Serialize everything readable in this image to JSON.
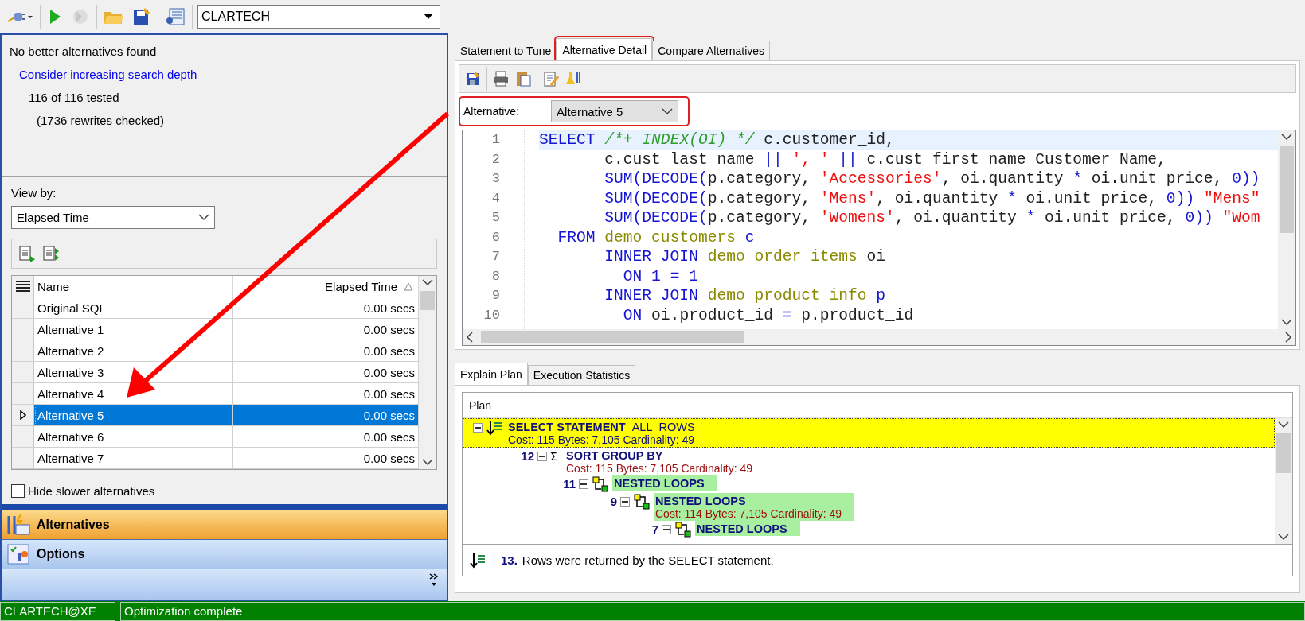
{
  "toolbar": {
    "connection": "CLARTECH"
  },
  "summary": {
    "message": "No better alternatives found",
    "link": "Consider increasing search depth",
    "tested": "116 of 116 tested",
    "rewrites": "(1736 rewrites checked)"
  },
  "view_by": {
    "label": "View by:",
    "value": "Elapsed Time"
  },
  "alternatives_table": {
    "columns": [
      {
        "label": "Name",
        "sorted": false
      },
      {
        "label": "Elapsed Time",
        "sorted": true
      }
    ],
    "rows": [
      {
        "name": "Original SQL",
        "elapsed": "0.00 secs",
        "selected": false
      },
      {
        "name": "Alternative 1",
        "elapsed": "0.00 secs",
        "selected": false
      },
      {
        "name": "Alternative 2",
        "elapsed": "0.00 secs",
        "selected": false
      },
      {
        "name": "Alternative 3",
        "elapsed": "0.00 secs",
        "selected": false
      },
      {
        "name": "Alternative 4",
        "elapsed": "0.00 secs",
        "selected": false
      },
      {
        "name": "Alternative 5",
        "elapsed": "0.00 secs",
        "selected": true
      },
      {
        "name": "Alternative 6",
        "elapsed": "0.00 secs",
        "selected": false
      },
      {
        "name": "Alternative 7",
        "elapsed": "0.00 secs",
        "selected": false
      }
    ]
  },
  "hide_slower": {
    "label": "Hide slower alternatives",
    "checked": false
  },
  "navigation": [
    {
      "label": "Alternatives",
      "selected": true
    },
    {
      "label": "Options",
      "selected": false
    }
  ],
  "tabs": [
    {
      "label": "Statement to Tune",
      "selected": false,
      "highlighted": false
    },
    {
      "label": "Alternative Detail",
      "selected": true,
      "highlighted": true
    },
    {
      "label": "Compare Alternatives",
      "selected": false,
      "highlighted": false
    }
  ],
  "detail": {
    "alternative_label": "Alternative:",
    "alternative_value": "Alternative 5",
    "highlighted": true,
    "code_lines": [
      {
        "number": "1",
        "tokens": [
          {
            "kind": "kw",
            "text": "SELECT"
          },
          {
            "kind": "cm",
            "text": " /*+ INDEX(OI) */"
          },
          {
            "kind": "id",
            "text": " c.customer_id,"
          }
        ]
      },
      {
        "number": "2",
        "tokens": [
          {
            "kind": "id",
            "text": "       c.cust_last_name "
          },
          {
            "kind": "op",
            "text": "||"
          },
          {
            "kind": "str",
            "text": " ', '"
          },
          {
            "kind": "op",
            "text": " ||"
          },
          {
            "kind": "id",
            "text": " c.cust_first_name Customer_Name,"
          }
        ]
      },
      {
        "number": "3",
        "tokens": [
          {
            "kind": "kw",
            "text": "       SUM(DECODE("
          },
          {
            "kind": "id",
            "text": "p.category, "
          },
          {
            "kind": "str",
            "text": "'Accessories'"
          },
          {
            "kind": "id",
            "text": ", oi.quantity "
          },
          {
            "kind": "op",
            "text": "*"
          },
          {
            "kind": "id",
            "text": " oi.unit_price, "
          },
          {
            "kind": "num",
            "text": "0"
          },
          {
            "kind": "kw",
            "text": "))"
          }
        ]
      },
      {
        "number": "4",
        "tokens": [
          {
            "kind": "kw",
            "text": "       SUM(DECODE("
          },
          {
            "kind": "id",
            "text": "p.category, "
          },
          {
            "kind": "str",
            "text": "'Mens'"
          },
          {
            "kind": "id",
            "text": ", oi.quantity "
          },
          {
            "kind": "op",
            "text": "*"
          },
          {
            "kind": "id",
            "text": " oi.unit_price, "
          },
          {
            "kind": "num",
            "text": "0"
          },
          {
            "kind": "kw",
            "text": "))"
          },
          {
            "kind": "str",
            "text": " \"Mens\""
          }
        ]
      },
      {
        "number": "5",
        "tokens": [
          {
            "kind": "kw",
            "text": "       SUM(DECODE("
          },
          {
            "kind": "id",
            "text": "p.category, "
          },
          {
            "kind": "str",
            "text": "'Womens'"
          },
          {
            "kind": "id",
            "text": ", oi.quantity "
          },
          {
            "kind": "op",
            "text": "*"
          },
          {
            "kind": "id",
            "text": " oi.unit_price, "
          },
          {
            "kind": "num",
            "text": "0"
          },
          {
            "kind": "kw",
            "text": "))"
          },
          {
            "kind": "str",
            "text": " \"Wom"
          }
        ]
      },
      {
        "number": "6",
        "tokens": [
          {
            "kind": "kw",
            "text": "  FROM"
          },
          {
            "kind": "tb",
            "text": " demo_customers"
          },
          {
            "kind": "kw",
            "text": " c"
          }
        ]
      },
      {
        "number": "7",
        "tokens": [
          {
            "kind": "kw",
            "text": "       INNER JOIN"
          },
          {
            "kind": "tb",
            "text": " demo_order_items"
          },
          {
            "kind": "id",
            "text": " oi"
          }
        ]
      },
      {
        "number": "8",
        "tokens": [
          {
            "kind": "kw",
            "text": "         ON"
          },
          {
            "kind": "num",
            "text": " 1"
          },
          {
            "kind": "op",
            "text": " ="
          },
          {
            "kind": "num",
            "text": " 1"
          }
        ]
      },
      {
        "number": "9",
        "tokens": [
          {
            "kind": "kw",
            "text": "       INNER JOIN"
          },
          {
            "kind": "tb",
            "text": " demo_product_info"
          },
          {
            "kind": "kw",
            "text": " p"
          }
        ]
      },
      {
        "number": "10",
        "tokens": [
          {
            "kind": "kw",
            "text": "         ON"
          },
          {
            "kind": "id",
            "text": " oi.product_id"
          },
          {
            "kind": "op",
            "text": " ="
          },
          {
            "kind": "id",
            "text": " p.product_id"
          }
        ]
      }
    ]
  },
  "plan_tabs": [
    {
      "label": "Explain Plan",
      "selected": true
    },
    {
      "label": "Execution Statistics",
      "selected": false
    }
  ],
  "plan": {
    "header": "Plan",
    "nodes": [
      {
        "kind": "select",
        "operation": "SELECT STATEMENT",
        "option": "ALL_ROWS",
        "details": "Cost: 115  Bytes: 7,105  Cardinality: 49",
        "selected": true,
        "highlighted": false,
        "children": [
          {
            "number": "12",
            "kind": "sum",
            "operation": "SORT GROUP BY",
            "details": "Cost: 115  Bytes: 7,105  Cardinality: 49",
            "selected": false,
            "highlighted": false,
            "children": [
              {
                "number": "11",
                "kind": "join",
                "operation": "NESTED LOOPS",
                "selected": false,
                "highlighted": true,
                "children": [
                  {
                    "number": "9",
                    "kind": "join",
                    "operation": "NESTED LOOPS",
                    "details": "Cost: 114  Bytes: 7,105  Cardinality: 49",
                    "selected": false,
                    "highlighted": true,
                    "children": [
                      {
                        "number": "7",
                        "kind": "join",
                        "operation": "NESTED LOOPS",
                        "selected": false,
                        "highlighted": true
                      }
                    ]
                  }
                ]
              }
            ]
          }
        ]
      }
    ],
    "footer": {
      "number": "13.",
      "text": "Rows were returned by the SELECT statement."
    }
  },
  "status_bar": {
    "connection": "CLARTECH@XE",
    "message": "Optimization complete"
  },
  "annotations": {
    "arrow": true
  }
}
